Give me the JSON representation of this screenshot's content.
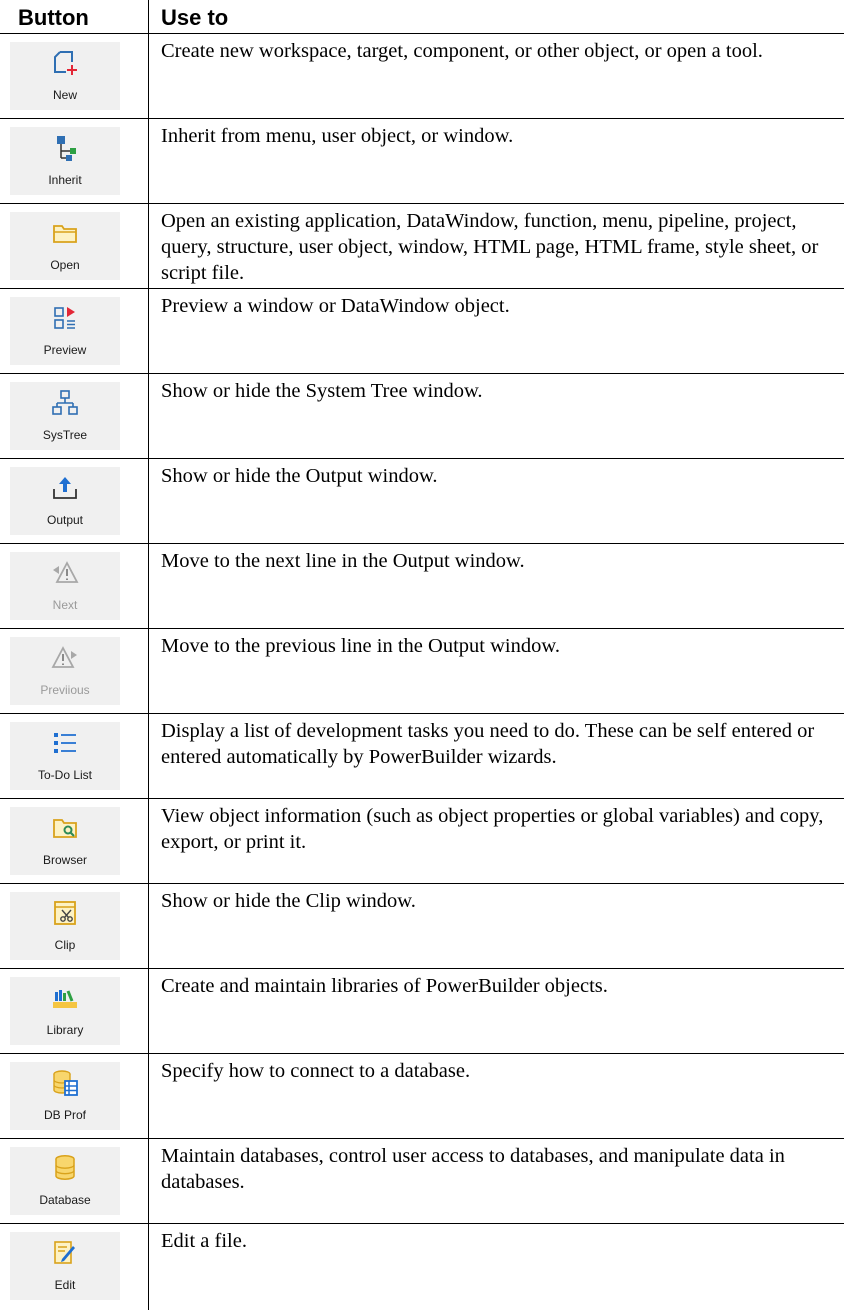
{
  "header": {
    "button_col": "Button",
    "use_col": "Use to"
  },
  "rows": [
    {
      "label": "New",
      "icon": "new-icon",
      "disabled": false,
      "desc": "Create new workspace, target, component, or other object, or open a tool."
    },
    {
      "label": "Inherit",
      "icon": "inherit-icon",
      "disabled": false,
      "desc": "Inherit from menu, user object, or window."
    },
    {
      "label": "Open",
      "icon": "open-folder-icon",
      "disabled": false,
      "desc": "Open an existing application, DataWindow, function, menu, pipeline, project, query, structure, user object, window, HTML page, HTML frame, style sheet, or script file."
    },
    {
      "label": "Preview",
      "icon": "preview-icon",
      "disabled": false,
      "desc": "Preview a window or DataWindow object."
    },
    {
      "label": "SysTree",
      "icon": "system-tree-icon",
      "disabled": false,
      "desc": "Show or hide the System Tree window."
    },
    {
      "label": "Output",
      "icon": "output-icon",
      "disabled": false,
      "desc": "Show or hide the Output window."
    },
    {
      "label": "Next",
      "icon": "next-warning-icon",
      "disabled": true,
      "desc": "Move to the next line in the Output window."
    },
    {
      "label": "Previious",
      "icon": "previous-warning-icon",
      "disabled": true,
      "desc": "Move to the previous line in the Output window."
    },
    {
      "label": "To-Do List",
      "icon": "todo-list-icon",
      "disabled": false,
      "desc": "Display a list of development tasks you need to do. These can be self entered or entered automatically by PowerBuilder wizards."
    },
    {
      "label": "Browser",
      "icon": "browser-icon",
      "disabled": false,
      "desc": "View object information (such as object properties or global variables) and copy, export, or print it."
    },
    {
      "label": "Clip",
      "icon": "clip-icon",
      "disabled": false,
      "desc": "Show or hide the Clip window."
    },
    {
      "label": "Library",
      "icon": "library-icon",
      "disabled": false,
      "desc": "Create and maintain libraries of PowerBuilder objects."
    },
    {
      "label": "DB Prof",
      "icon": "db-profile-icon",
      "disabled": false,
      "desc": "Specify how to connect to a database."
    },
    {
      "label": "Database",
      "icon": "database-icon",
      "disabled": false,
      "desc": "Maintain databases, control user access to databases, and manipulate data in databases."
    },
    {
      "label": "Edit",
      "icon": "edit-icon",
      "disabled": false,
      "desc": "Edit a file."
    }
  ]
}
